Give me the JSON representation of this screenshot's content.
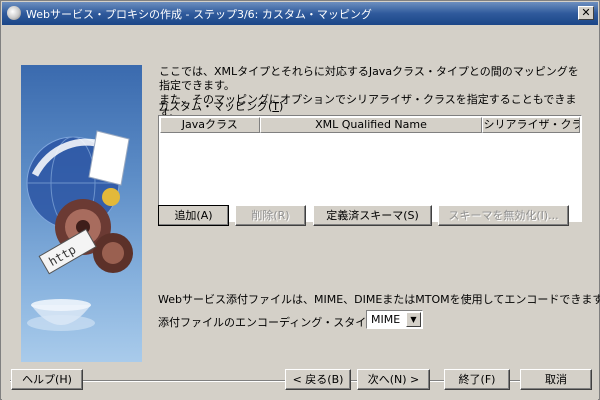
{
  "window": {
    "title": "Webサービス・プロキシの作成 - ステップ3/6: カスタム・マッピング",
    "close_label": "✕"
  },
  "description": {
    "line1": "ここでは、XMLタイプとそれらに対応するJavaクラス・タイプとの間のマッピングを指定できます。",
    "line2": "また、そのマッピングにオプションでシリアライザ・クラスを指定することもできます。"
  },
  "mapping_table": {
    "label": "カスタム・マッピング(",
    "label_mnemonic": "T",
    "label_suffix": ")",
    "columns": [
      "Javaクラス",
      "XML Qualified Name",
      "シリアライザ・クラス"
    ],
    "rows": []
  },
  "table_buttons": {
    "add": "追加(A)",
    "remove": "削除(R)",
    "defined_schema": "定義済スキーマ(S)",
    "disable_schema": "スキーマを無効化(I)..."
  },
  "attachment": {
    "info": "Webサービス添付ファイルは、MIME、DIMEまたはMTOMを使用してエンコードできます。",
    "encoding_label": "添付ファイルのエンコーディング・スタイル(D):",
    "encoding_value": "MIME"
  },
  "footer": {
    "help": "ヘルプ(H)",
    "back": "< 戻る(B)",
    "next": "次へ(N) >",
    "finish": "終了(F)",
    "cancel": "取消"
  }
}
